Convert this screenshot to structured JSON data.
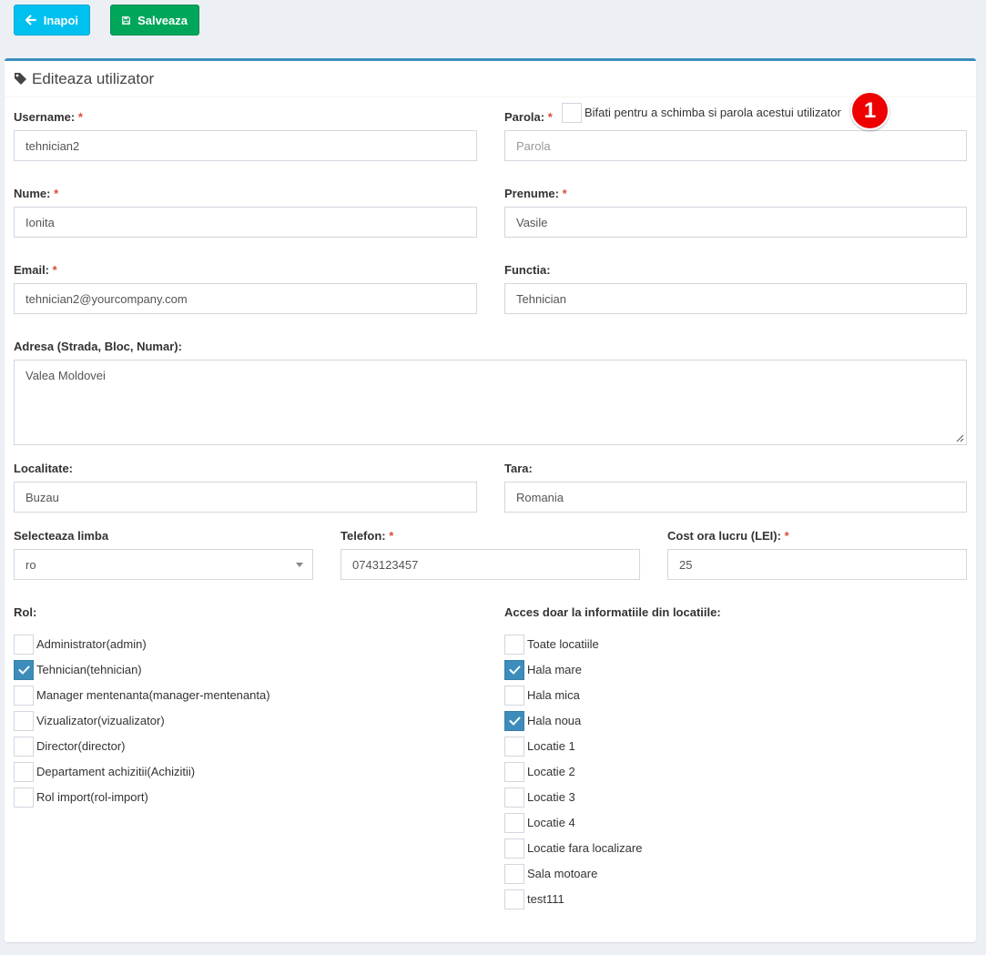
{
  "toolbar": {
    "back_label": "Inapoi",
    "save_label": "Salveaza"
  },
  "box": {
    "title": "Editeaza utilizator"
  },
  "form": {
    "username": {
      "label": "Username:",
      "required": "*",
      "value": "tehnician2"
    },
    "parola": {
      "label": "Parola:",
      "required": "*",
      "checkbox_label": "Bifati pentru a schimba si parola acestui utilizator",
      "placeholder": "Parola"
    },
    "nume": {
      "label": "Nume:",
      "required": "*",
      "value": "Ionita"
    },
    "prenume": {
      "label": "Prenume:",
      "required": "*",
      "value": "Vasile"
    },
    "email": {
      "label": "Email:",
      "required": "*",
      "value": "tehnician2@yourcompany.com"
    },
    "functia": {
      "label": "Functia:",
      "value": "Tehnician"
    },
    "adresa": {
      "label": "Adresa (Strada, Bloc, Numar):",
      "value": "Valea Moldovei"
    },
    "localitate": {
      "label": "Localitate:",
      "value": "Buzau"
    },
    "tara": {
      "label": "Tara:",
      "value": "Romania"
    },
    "limba": {
      "label": "Selecteaza limba",
      "value": "ro"
    },
    "telefon": {
      "label": "Telefon:",
      "required": "*",
      "value": "0743123457"
    },
    "cost": {
      "label": "Cost ora lucru (LEI):",
      "required": "*",
      "value": "25"
    },
    "rol": {
      "label": "Rol:",
      "items": [
        {
          "label": "Administrator(admin)",
          "checked": false
        },
        {
          "label": "Tehnician(tehnician)",
          "checked": true
        },
        {
          "label": "Manager mentenanta(manager-mentenanta)",
          "checked": false
        },
        {
          "label": "Vizualizator(vizualizator)",
          "checked": false
        },
        {
          "label": "Director(director)",
          "checked": false
        },
        {
          "label": "Departament achizitii(Achizitii)",
          "checked": false
        },
        {
          "label": "Rol import(rol-import)",
          "checked": false
        }
      ]
    },
    "acces": {
      "label": "Acces doar la informatiile din locatiile:",
      "items": [
        {
          "label": "Toate locatiile",
          "checked": false
        },
        {
          "label": "Hala mare",
          "checked": true
        },
        {
          "label": "Hala mica",
          "checked": false
        },
        {
          "label": "Hala noua",
          "checked": true
        },
        {
          "label": "Locatie 1",
          "checked": false
        },
        {
          "label": "Locatie 2",
          "checked": false
        },
        {
          "label": "Locatie 3",
          "checked": false
        },
        {
          "label": "Locatie 4",
          "checked": false
        },
        {
          "label": "Locatie fara localizare",
          "checked": false
        },
        {
          "label": "Sala motoare",
          "checked": false
        },
        {
          "label": "test111",
          "checked": false
        }
      ]
    }
  },
  "annotation": {
    "badge": "1"
  },
  "colors": {
    "primary": "#3c8dbc",
    "info": "#00c0ef",
    "success": "#00a65a",
    "danger": "#dd4b39"
  }
}
